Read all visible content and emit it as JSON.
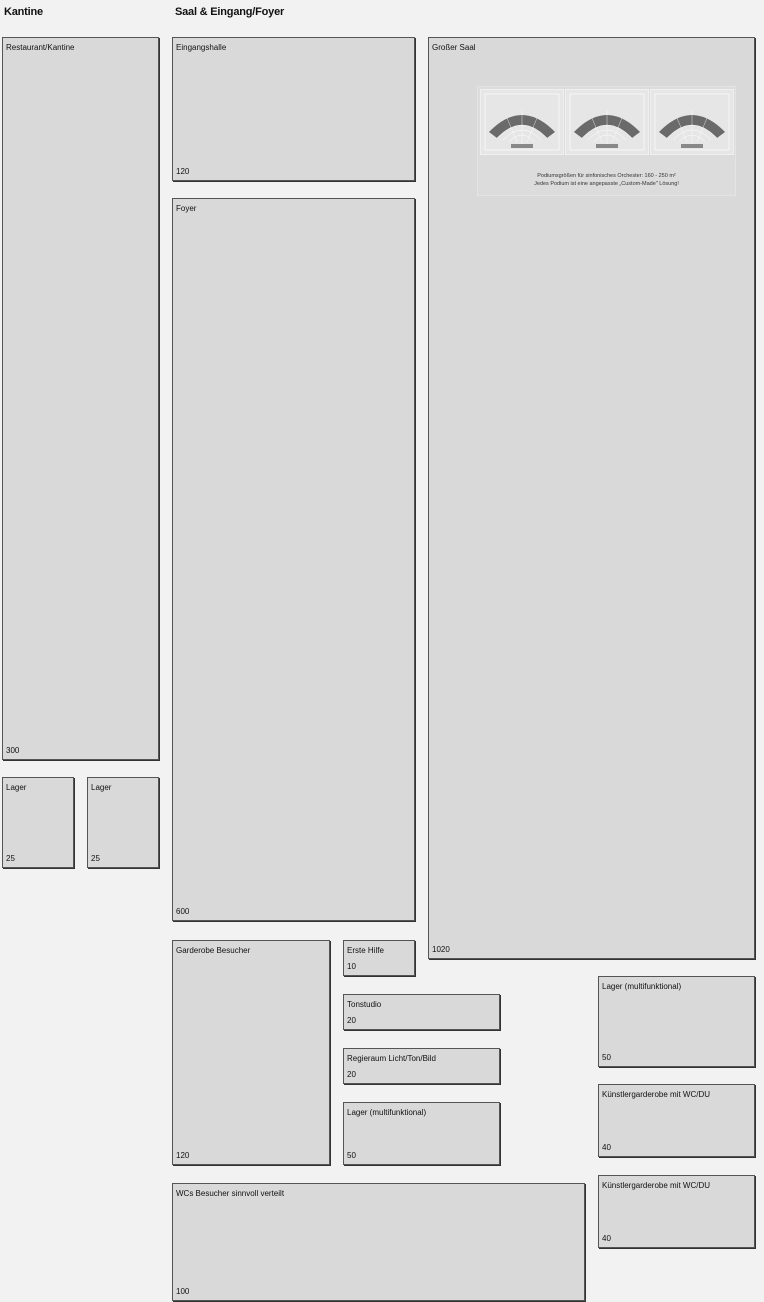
{
  "headings": {
    "kantine": "Kantine",
    "saal": "Saal & Eingang/Foyer"
  },
  "rooms": {
    "restaurant": {
      "label": "Restaurant/Kantine",
      "area": "300"
    },
    "lager_a": {
      "label": "Lager",
      "area": "25"
    },
    "lager_b": {
      "label": "Lager",
      "area": "25"
    },
    "eingangshalle": {
      "label": "Eingangshalle",
      "area": "120"
    },
    "foyer": {
      "label": "Foyer",
      "area": "600"
    },
    "grosser_saal": {
      "label": "Großer Saal",
      "area": "1020"
    },
    "garderobe": {
      "label": "Garderobe Besucher",
      "area": "120"
    },
    "erste_hilfe": {
      "label": "Erste Hilfe",
      "area": "10"
    },
    "tonstudio": {
      "label": "Tonstudio",
      "area": "20"
    },
    "regieraum": {
      "label": "Regieraum Licht/Ton/Bild",
      "area": "20"
    },
    "lager_multi_1": {
      "label": "Lager (multifunktional)",
      "area": "50"
    },
    "lager_multi_2": {
      "label": "Lager (multifunktional)",
      "area": "50"
    },
    "kuenstler_1": {
      "label": "Künstlergarderobe mit WC/DU",
      "area": "40"
    },
    "kuenstler_2": {
      "label": "Künstlergarderobe mit WC/DU",
      "area": "40"
    },
    "wcs": {
      "label": "WCs Besucher sinnvoll verteilt",
      "area": "100"
    }
  },
  "podium": {
    "caption_line1": "Podiumsgrößen für sinfonisches Orchester: 160 - 250 m²",
    "caption_line2": "Jedes Podium ist eine angepasste „Custom-Made\" Lösung!",
    "images": [
      "podium-plan-icon",
      "podium-plan-icon",
      "podium-plan-icon"
    ]
  }
}
